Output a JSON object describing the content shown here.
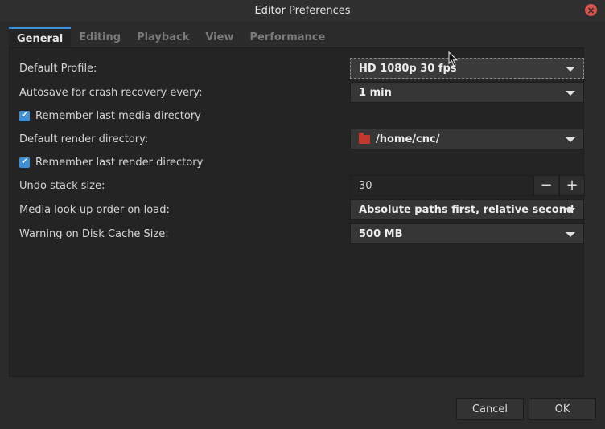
{
  "window": {
    "title": "Editor Preferences"
  },
  "tabs": [
    {
      "label": "General",
      "active": true
    },
    {
      "label": "Editing",
      "active": false
    },
    {
      "label": "Playback",
      "active": false
    },
    {
      "label": "View",
      "active": false
    },
    {
      "label": "Performance",
      "active": false
    }
  ],
  "general": {
    "default_profile": {
      "label": "Default Profile:",
      "value": "HD 1080p 30 fps"
    },
    "autosave": {
      "label": "Autosave for crash recovery every:",
      "value": "1 min"
    },
    "remember_media_dir": {
      "label": "Remember last media directory",
      "checked": true
    },
    "render_dir": {
      "label": "Default render directory:",
      "value": "/home/cnc/"
    },
    "remember_render_dir": {
      "label": "Remember last render directory",
      "checked": true
    },
    "undo_stack": {
      "label": "Undo stack size:",
      "value": "30",
      "minus": "−",
      "plus": "+"
    },
    "lookup_order": {
      "label": "Media look-up order on load:",
      "value": "Absolute paths first, relative second"
    },
    "disk_cache_warning": {
      "label": "Warning on Disk Cache Size:",
      "value": "500 MB"
    }
  },
  "buttons": {
    "cancel": "Cancel",
    "ok": "OK"
  },
  "colors": {
    "accent": "#3d8fd6",
    "close": "#d9534f",
    "folder": "#c0392b"
  },
  "icons": {
    "close": "close-icon",
    "check": "checkmark-icon",
    "folder": "folder-icon",
    "dropdown": "chevron-down-icon"
  }
}
